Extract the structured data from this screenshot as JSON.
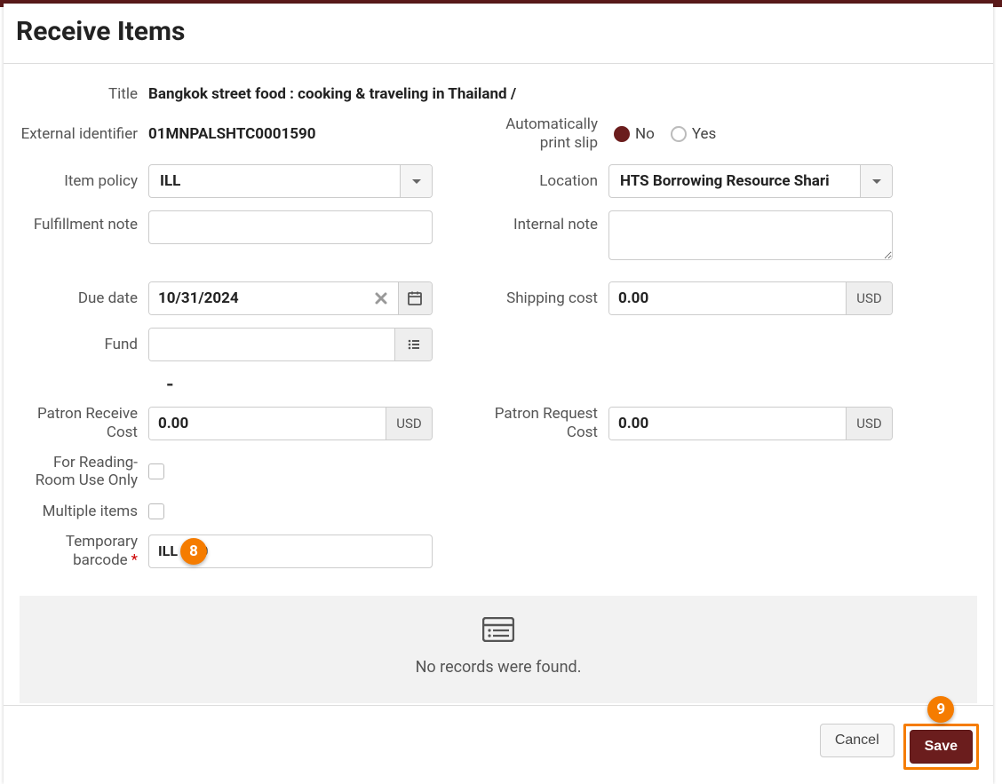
{
  "header": {
    "title": "Receive Items"
  },
  "labels": {
    "title": "Title",
    "external_id": "External identifier",
    "item_policy": "Item policy",
    "fulfillment_note": "Fulfillment note",
    "due_date": "Due date",
    "fund": "Fund",
    "patron_receive_cost": "Patron Receive Cost",
    "for_reading_room": "For Reading-Room Use Only",
    "multiple_items": "Multiple items",
    "temporary_barcode": "Temporary barcode",
    "auto_print_slip": "Automatically print slip",
    "location": "Location",
    "internal_note": "Internal note",
    "shipping_cost": "Shipping cost",
    "patron_request_cost": "Patron Request Cost"
  },
  "values": {
    "title": "Bangkok street food : cooking & traveling in Thailand /",
    "external_id": "01MNPALSHTC0001590",
    "item_policy": "ILL",
    "fulfillment_note": "",
    "due_date": "10/31/2024",
    "fund": "",
    "patron_receive_cost": "0.00",
    "temporary_barcode": "ILL    90",
    "auto_print_slip": "No",
    "location": "HTS Borrowing Resource Shari",
    "internal_note": "",
    "shipping_cost": "0.00",
    "patron_request_cost": "0.00",
    "currency": "USD"
  },
  "radio": {
    "no": "No",
    "yes": "Yes"
  },
  "empty": {
    "message": "No records were found."
  },
  "footer": {
    "cancel": "Cancel",
    "save": "Save"
  },
  "markers": {
    "m8": "8",
    "m9": "9"
  }
}
